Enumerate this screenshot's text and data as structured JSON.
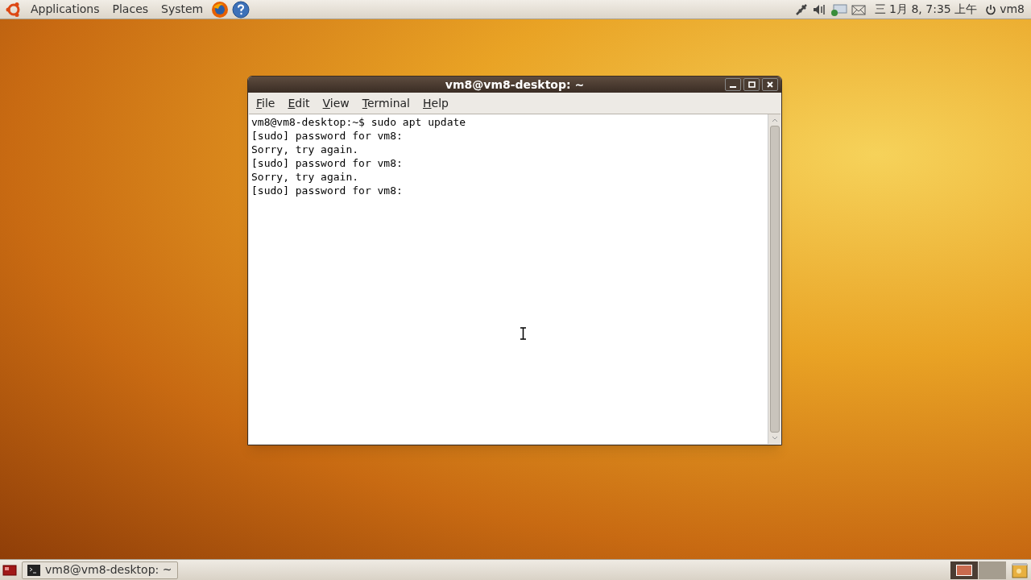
{
  "top_panel": {
    "menus": [
      "Applications",
      "Places",
      "System"
    ],
    "clock": "三 1月 8, 7:35 上午",
    "user": "vm8"
  },
  "window": {
    "title": "vm8@vm8-desktop: ~",
    "menus": [
      "File",
      "Edit",
      "View",
      "Terminal",
      "Help"
    ],
    "lines": [
      "vm8@vm8-desktop:~$ sudo apt update",
      "[sudo] password for vm8:",
      "Sorry, try again.",
      "[sudo] password for vm8:",
      "Sorry, try again.",
      "[sudo] password for vm8:"
    ]
  },
  "taskbar": {
    "tasks": [
      {
        "label": "vm8@vm8-desktop: ~",
        "selected": false
      }
    ],
    "workspaces": [
      {
        "selected": true
      },
      {
        "selected": false
      }
    ]
  }
}
